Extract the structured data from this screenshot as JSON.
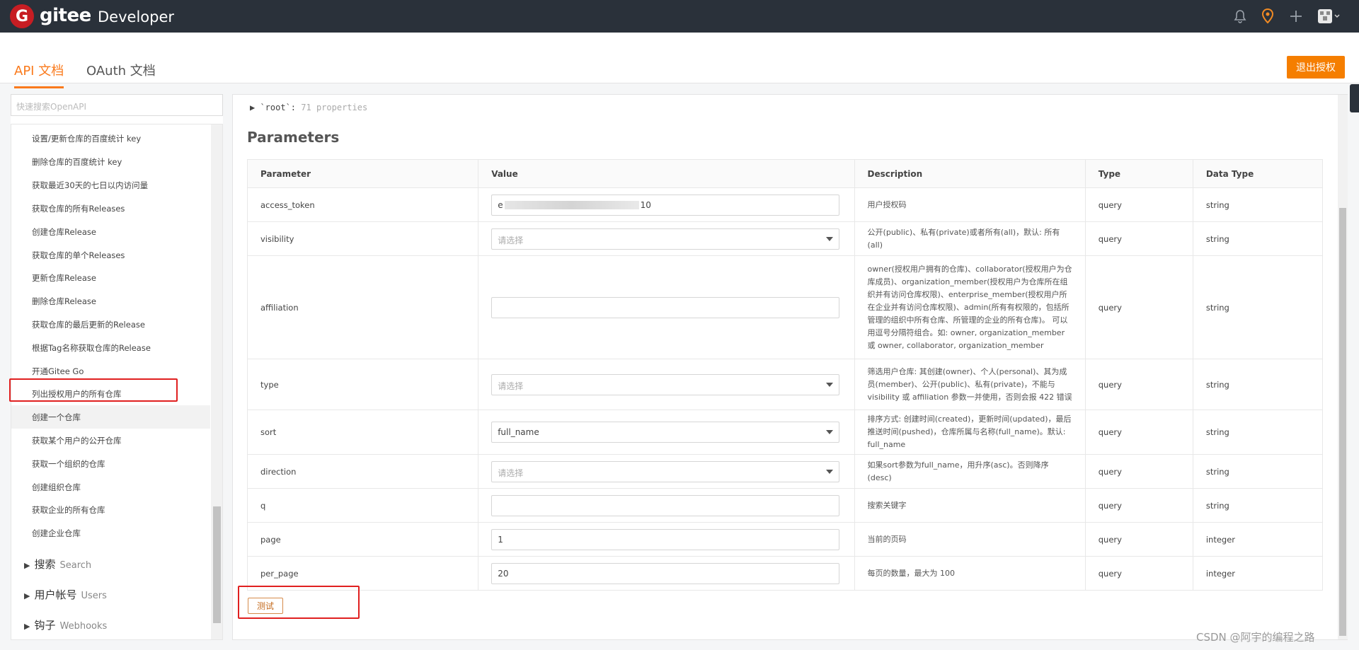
{
  "topbar": {
    "logo_letter": "G",
    "brand": "gitee",
    "subtitle": "Developer",
    "icons": [
      "bell-icon",
      "location-pin-icon",
      "plus-icon",
      "avatar"
    ]
  },
  "header": {
    "tabs": [
      {
        "label": "API 文档",
        "active": true
      },
      {
        "label": "OAuth 文档",
        "active": false
      }
    ],
    "logout_label": "退出授权"
  },
  "sidebar": {
    "search_placeholder": "快速搜索OpenAPI",
    "items": [
      "设置/更新仓库的百度统计 key",
      "删除仓库的百度统计 key",
      "获取最近30天的七日以内访问量",
      "获取仓库的所有Releases",
      "创建仓库Release",
      "获取仓库的单个Releases",
      "更新仓库Release",
      "删除仓库Release",
      "获取仓库的最后更新的Release",
      "根据Tag名称获取仓库的Release",
      "开通Gitee Go",
      "列出授权用户的所有仓库",
      "创建一个仓库",
      "获取某个用户的公开仓库",
      "获取一个组织的仓库",
      "创建组织仓库",
      "获取企业的所有仓库",
      "创建企业仓库"
    ],
    "selected_index": 11,
    "groups": [
      {
        "cn": "搜索",
        "en": "Search"
      },
      {
        "cn": "用户帐号",
        "en": "Users"
      },
      {
        "cn": "钩子",
        "en": "Webhooks"
      }
    ]
  },
  "main": {
    "root_label": "`root`:",
    "root_props": "71 properties",
    "params_title": "Parameters",
    "columns": [
      "Parameter",
      "Value",
      "Description",
      "Type",
      "Data Type"
    ],
    "rows": [
      {
        "param": "access_token",
        "value_prefix": "e",
        "value_suffix": "10",
        "placeholder": "",
        "select": false,
        "desc": "用户授权码",
        "type": "query",
        "data_type": "string"
      },
      {
        "param": "visibility",
        "value": "",
        "placeholder": "请选择",
        "select": true,
        "desc": "公开(public)、私有(private)或者所有(all)，默认: 所有(all)",
        "type": "query",
        "data_type": "string"
      },
      {
        "param": "affiliation",
        "value": "",
        "placeholder": "",
        "select": false,
        "desc": "owner(授权用户拥有的仓库)、collaborator(授权用户为仓库成员)、organization_member(授权用户为仓库所在组织并有访问仓库权限)、enterprise_member(授权用户所在企业并有访问仓库权限)、admin(所有有权限的，包括所管理的组织中所有仓库、所管理的企业的所有仓库)。 可以用逗号分隔符组合。如: owner, organization_member 或 owner, collaborator, organization_member",
        "type": "query",
        "data_type": "string"
      },
      {
        "param": "type",
        "value": "",
        "placeholder": "请选择",
        "select": true,
        "desc": "筛选用户仓库: 其创建(owner)、个人(personal)、其为成员(member)、公开(public)、私有(private)，不能与 visibility 或 affiliation 参数一并使用，否则会报 422 错误",
        "type": "query",
        "data_type": "string"
      },
      {
        "param": "sort",
        "value": "full_name",
        "placeholder": "",
        "select": true,
        "desc": "排序方式: 创建时间(created)，更新时间(updated)，最后推送时间(pushed)，仓库所属与名称(full_name)。默认: full_name",
        "type": "query",
        "data_type": "string"
      },
      {
        "param": "direction",
        "value": "",
        "placeholder": "请选择",
        "select": true,
        "desc": "如果sort参数为full_name，用升序(asc)。否则降序(desc)",
        "type": "query",
        "data_type": "string"
      },
      {
        "param": "q",
        "value": "",
        "placeholder": "",
        "select": false,
        "desc": "搜索关键字",
        "type": "query",
        "data_type": "string"
      },
      {
        "param": "page",
        "value": "1",
        "placeholder": "",
        "select": false,
        "desc": "当前的页码",
        "type": "query",
        "data_type": "integer"
      },
      {
        "param": "per_page",
        "value": "20",
        "placeholder": "",
        "select": false,
        "desc": "每页的数量，最大为 100",
        "type": "query",
        "data_type": "integer"
      }
    ],
    "test_label": "测试"
  },
  "watermark": "CSDN @阿宇的编程之路"
}
